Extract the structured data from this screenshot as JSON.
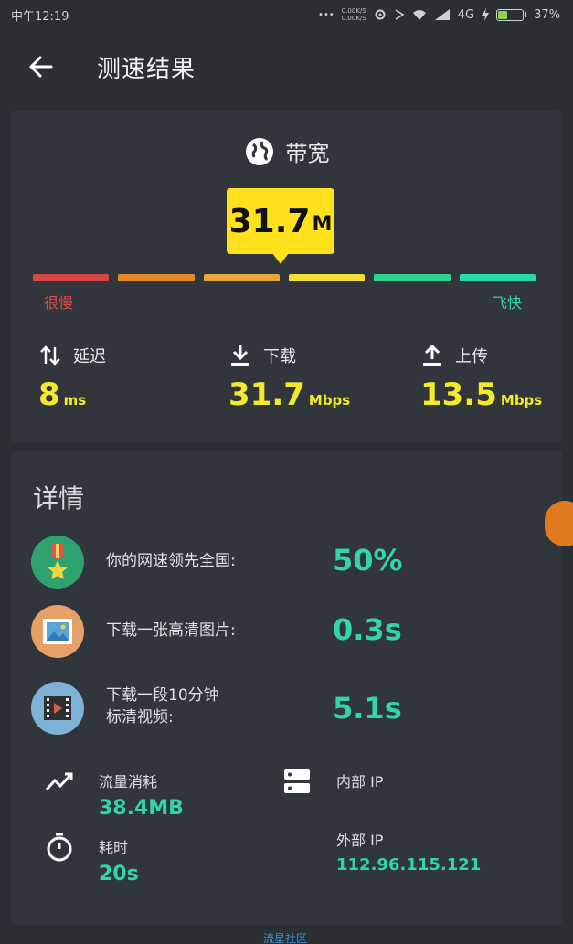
{
  "status": {
    "time": "中午12:19",
    "network": "4G",
    "battery": "37%",
    "speed_top": "0.00K/S",
    "speed_bottom": "0.00K/S",
    "dots": "•••"
  },
  "appbar": {
    "title": "测速结果"
  },
  "bandwidth": {
    "label": "带宽",
    "value": "31.7",
    "unit": "M",
    "scale_low": "很慢",
    "scale_high": "飞快",
    "scale_colors": [
      "#d94444",
      "#e8862c",
      "#e6a63a",
      "#f2e030",
      "#2fd38a",
      "#27d8a8"
    ]
  },
  "metrics": {
    "latency": {
      "label": "延迟",
      "value": "8",
      "unit": "ms"
    },
    "download": {
      "label": "下载",
      "value": "31.7",
      "unit": "Mbps"
    },
    "upload": {
      "label": "上传",
      "value": "13.5",
      "unit": "Mbps"
    }
  },
  "details": {
    "title": "详情",
    "rows": [
      {
        "icon": "medal-icon",
        "label": "你的网速领先全国:",
        "value": "50%",
        "color": "#2fa36f"
      },
      {
        "icon": "picture-icon",
        "label": "下载一张高清图片:",
        "value": "0.3s",
        "color": "#e8a06a"
      },
      {
        "icon": "video-icon",
        "label_line1": "下载一段10分钟",
        "label_line2": "标清视频:",
        "value": "5.1s",
        "color": "#7fb3d6"
      }
    ],
    "traffic": {
      "label": "流量消耗",
      "value": "38.4MB"
    },
    "duration": {
      "label": "耗时",
      "value": "20s"
    },
    "internal_ip": {
      "label": "内部 IP",
      "value": ""
    },
    "external_ip": {
      "label": "外部 IP",
      "value": "112.96.115.121"
    }
  },
  "watermark": "流星社区"
}
